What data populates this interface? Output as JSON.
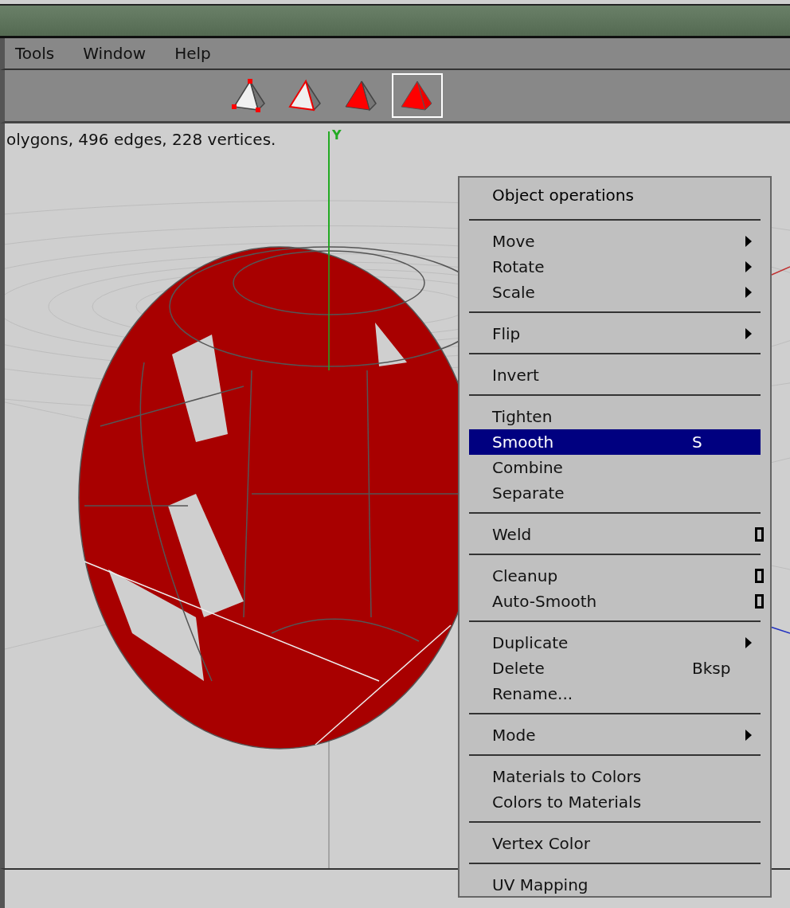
{
  "menubar": [
    {
      "label": "Tools"
    },
    {
      "label": "Window"
    },
    {
      "label": "Help"
    }
  ],
  "toolbar": {
    "modes": [
      {
        "kind": "vertex",
        "selected": false
      },
      {
        "kind": "edge",
        "selected": false
      },
      {
        "kind": "face",
        "selected": false
      },
      {
        "kind": "body",
        "selected": true
      }
    ]
  },
  "viewport": {
    "status": "olygons, 496 edges, 228 vertices.",
    "axis_label": "Y"
  },
  "context_menu": {
    "items": [
      {
        "kind": "header",
        "label": "Object operations"
      },
      {
        "kind": "separator"
      },
      {
        "kind": "item",
        "label": "Move",
        "submenu": true,
        "option": false,
        "selected": false
      },
      {
        "kind": "item",
        "label": "Rotate",
        "submenu": true,
        "option": false,
        "selected": false
      },
      {
        "kind": "item",
        "label": "Scale",
        "submenu": true,
        "option": false,
        "selected": false
      },
      {
        "kind": "separator"
      },
      {
        "kind": "item",
        "label": "Flip",
        "submenu": true,
        "option": false,
        "selected": false
      },
      {
        "kind": "separator"
      },
      {
        "kind": "item",
        "label": "Invert",
        "submenu": false,
        "option": false,
        "selected": false
      },
      {
        "kind": "separator"
      },
      {
        "kind": "item",
        "label": "Tighten",
        "submenu": false,
        "option": false,
        "selected": false
      },
      {
        "kind": "item",
        "label": "Smooth",
        "shortcut": "S",
        "submenu": false,
        "option": false,
        "selected": true
      },
      {
        "kind": "item",
        "label": "Combine",
        "submenu": false,
        "option": false,
        "selected": false
      },
      {
        "kind": "item",
        "label": "Separate",
        "submenu": false,
        "option": false,
        "selected": false
      },
      {
        "kind": "separator"
      },
      {
        "kind": "item",
        "label": "Weld",
        "submenu": false,
        "option": true,
        "selected": false
      },
      {
        "kind": "separator"
      },
      {
        "kind": "item",
        "label": "Cleanup",
        "submenu": false,
        "option": true,
        "selected": false
      },
      {
        "kind": "item",
        "label": "Auto-Smooth",
        "submenu": false,
        "option": true,
        "selected": false
      },
      {
        "kind": "separator"
      },
      {
        "kind": "item",
        "label": "Duplicate",
        "submenu": true,
        "option": false,
        "selected": false
      },
      {
        "kind": "item",
        "label": "Delete",
        "shortcut": "Bksp",
        "submenu": false,
        "option": false,
        "selected": false
      },
      {
        "kind": "item",
        "label": "Rename...",
        "submenu": false,
        "option": false,
        "selected": false
      },
      {
        "kind": "separator"
      },
      {
        "kind": "item",
        "label": "Mode",
        "submenu": true,
        "option": false,
        "selected": false
      },
      {
        "kind": "separator"
      },
      {
        "kind": "item",
        "label": "Materials to Colors",
        "submenu": false,
        "option": false,
        "selected": false
      },
      {
        "kind": "item",
        "label": "Colors to Materials",
        "submenu": false,
        "option": false,
        "selected": false
      },
      {
        "kind": "separator"
      },
      {
        "kind": "item",
        "label": "Vertex Color",
        "submenu": false,
        "option": false,
        "selected": false
      },
      {
        "kind": "separator"
      },
      {
        "kind": "item",
        "label": "UV Mapping",
        "submenu": false,
        "option": false,
        "selected": false
      }
    ]
  }
}
